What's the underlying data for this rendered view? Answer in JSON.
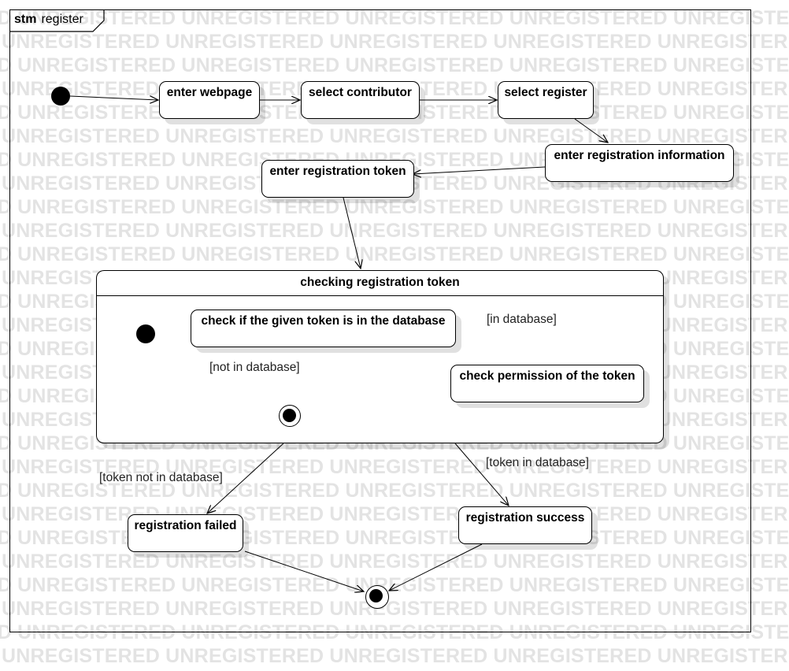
{
  "frame": {
    "keyword": "stm",
    "name": "register"
  },
  "watermark_text": "UNREGISTERED",
  "states": {
    "enter_webpage": "enter webpage",
    "select_contributor": "select contributor",
    "select_register": "select register",
    "enter_registration_information": "enter registration information",
    "enter_registration_token": "enter registration token",
    "registration_failed": "registration failed",
    "registration_success": "registration success"
  },
  "composite": {
    "title": "checking registration token",
    "states": {
      "check_token_in_database": "check if the given token is in the database",
      "check_permission": "check permission of the token"
    },
    "guards": {
      "in_database": "[in database]",
      "not_in_database": "[not in database]"
    }
  },
  "guards": {
    "token_not_in_database": "[token not in database]",
    "token_in_database": "[token in database]"
  },
  "colors": {
    "line": "#000000",
    "watermark": "#e3e3e3",
    "shadow": "rgba(0,0,0,0.12)"
  }
}
